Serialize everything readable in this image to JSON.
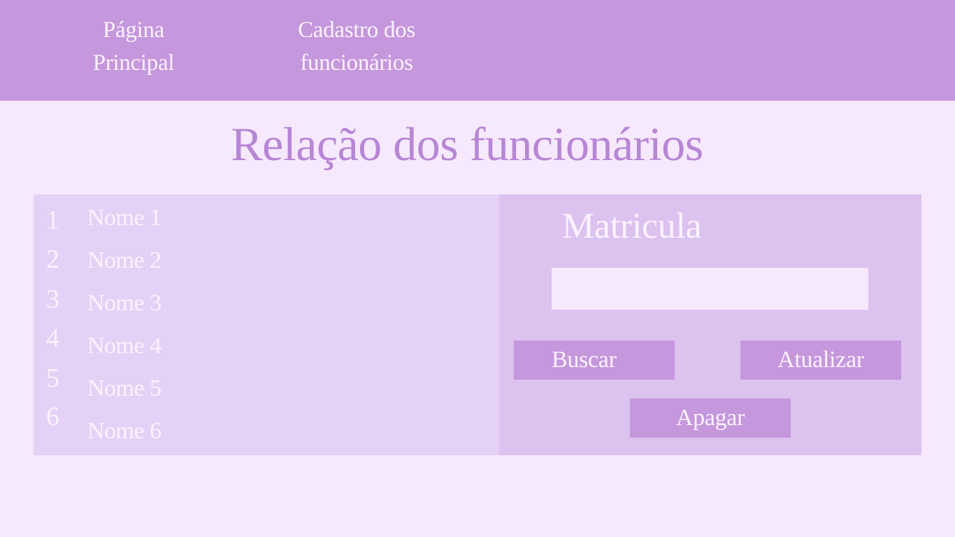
{
  "nav": {
    "home": [
      "Página",
      "Principal"
    ],
    "cadastro": [
      "Cadastro dos",
      "funcionários"
    ]
  },
  "page_title": "Relação dos funcionários",
  "employees": [
    {
      "number": "1",
      "name": "Nome 1"
    },
    {
      "number": "2",
      "name": "Nome 2"
    },
    {
      "number": "3",
      "name": "Nome 3"
    },
    {
      "number": "4",
      "name": "Nome 4"
    },
    {
      "number": "5",
      "name": "Nome 5"
    },
    {
      "number": "6",
      "name": "Nome 6"
    }
  ],
  "form": {
    "label": "Matricula",
    "input_value": "",
    "buttons": {
      "search": "Buscar",
      "update": "Atualizar",
      "delete": "Apagar"
    }
  },
  "colors": {
    "header": "#c597dc",
    "background": "#f6e9fe",
    "title": "#b786d5",
    "list_panel": "#e5d1f5",
    "form_panel": "#dcc2ef",
    "text_light": "#fbf2ff"
  }
}
